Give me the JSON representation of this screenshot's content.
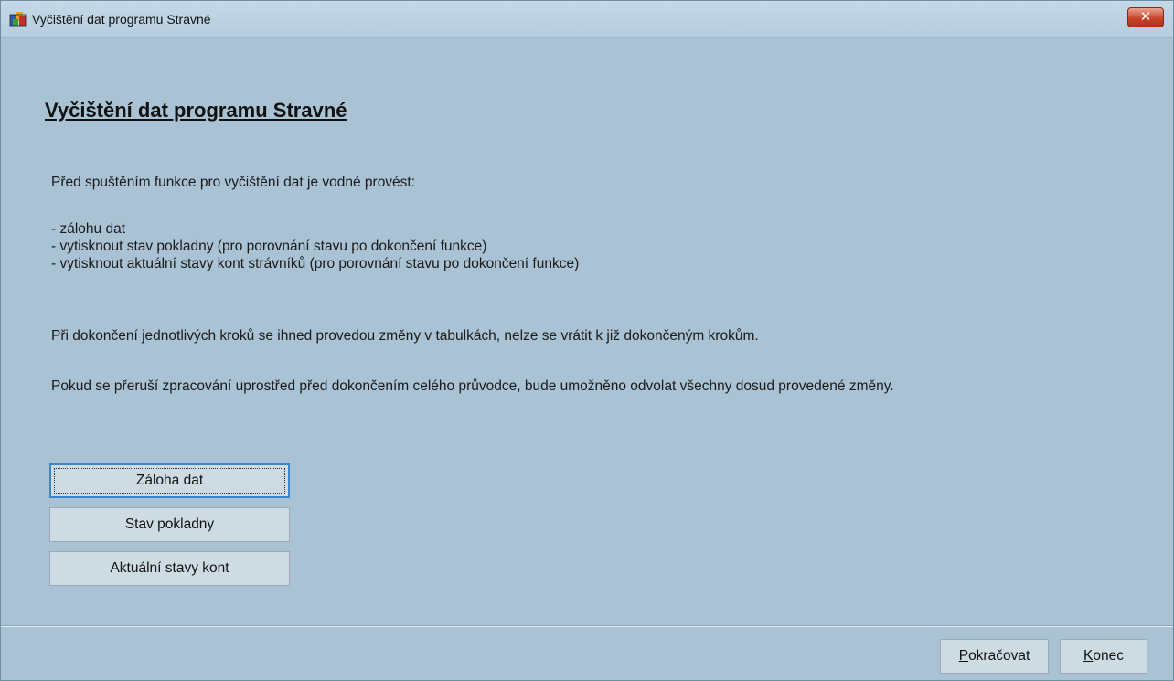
{
  "window": {
    "title": "Vyčištění dat programu Stravné",
    "close_glyph": "✕"
  },
  "content": {
    "heading": "Vyčištění dat programu Stravné",
    "intro": "Před spuštěním funkce pro vyčištění dat je vodné provést:",
    "items": [
      "- zálohu dat",
      "- vytisknout stav pokladny (pro porovnání stavu po dokončení funkce)",
      "- vytisknout aktuální stavy kont strávníků (pro porovnání stavu po dokončení funkce)"
    ],
    "note1": "Při dokončení jednotlivých kroků se ihned provedou změny v tabulkách, nelze se vrátit k již dokončeným krokům.",
    "note2": "Pokud se přeruší zpracování uprostřed před dokončením celého průvodce, bude umožněno odvolat všechny dosud provedené změny."
  },
  "actions": {
    "backup": "Záloha dat",
    "cash_status": "Stav pokladny",
    "accounts": "Aktuální stavy kont"
  },
  "footer": {
    "continue_mnemonic": "P",
    "continue_rest": "okračovat",
    "end_mnemonic": "K",
    "end_rest": "onec"
  },
  "colors": {
    "window_bg": "#a9c3d4",
    "button_bg": "#cfdbe3",
    "focus_border": "#3c86c8",
    "close_red": "#c8452b"
  },
  "icons": {
    "app": "app-icon",
    "close": "close-icon"
  }
}
